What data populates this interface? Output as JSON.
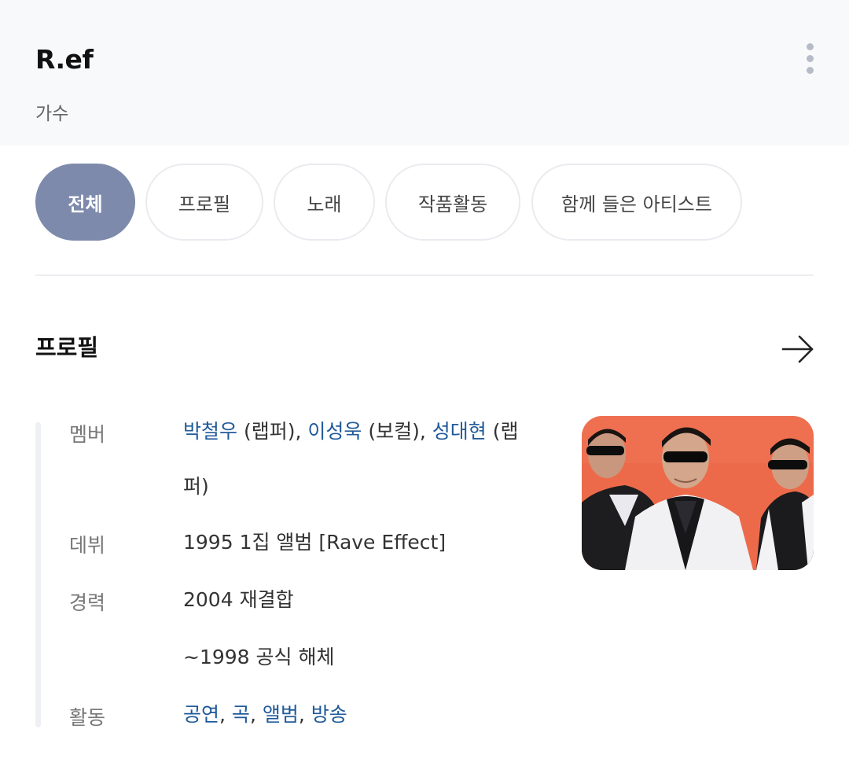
{
  "header": {
    "title": "R.ef",
    "subtitle": "가수",
    "more_icon": "more-vertical-icon"
  },
  "tabs": [
    {
      "label": "전체",
      "active": true
    },
    {
      "label": "프로필",
      "active": false
    },
    {
      "label": "노래",
      "active": false
    },
    {
      "label": "작품활동",
      "active": false
    },
    {
      "label": "함께 들은 아티스트",
      "active": false
    }
  ],
  "profile": {
    "section_title": "프로필",
    "arrow_icon": "arrow-right-icon",
    "rows": {
      "members": {
        "label": "멤버",
        "m1_name": "박철우",
        "m1_role": " (랩퍼), ",
        "m2_name": "이성욱",
        "m2_role": " (보컬), ",
        "m3_name": "성대현",
        "m3_role": " (랩퍼)"
      },
      "debut": {
        "label": "데뷔",
        "value": "1995 1집 앨범 [Rave Effect]"
      },
      "career": {
        "label": "경력",
        "line1": "2004 재결합",
        "line2": "~1998 공식 해체"
      },
      "activity": {
        "label": "활동",
        "links": [
          "공연",
          "곡",
          "앨범",
          "방송"
        ],
        "sep": ", "
      }
    },
    "photo_alt": "R.ef group photo"
  },
  "colors": {
    "accent_tab": "#7d8aab",
    "link": "#1f5a99"
  }
}
